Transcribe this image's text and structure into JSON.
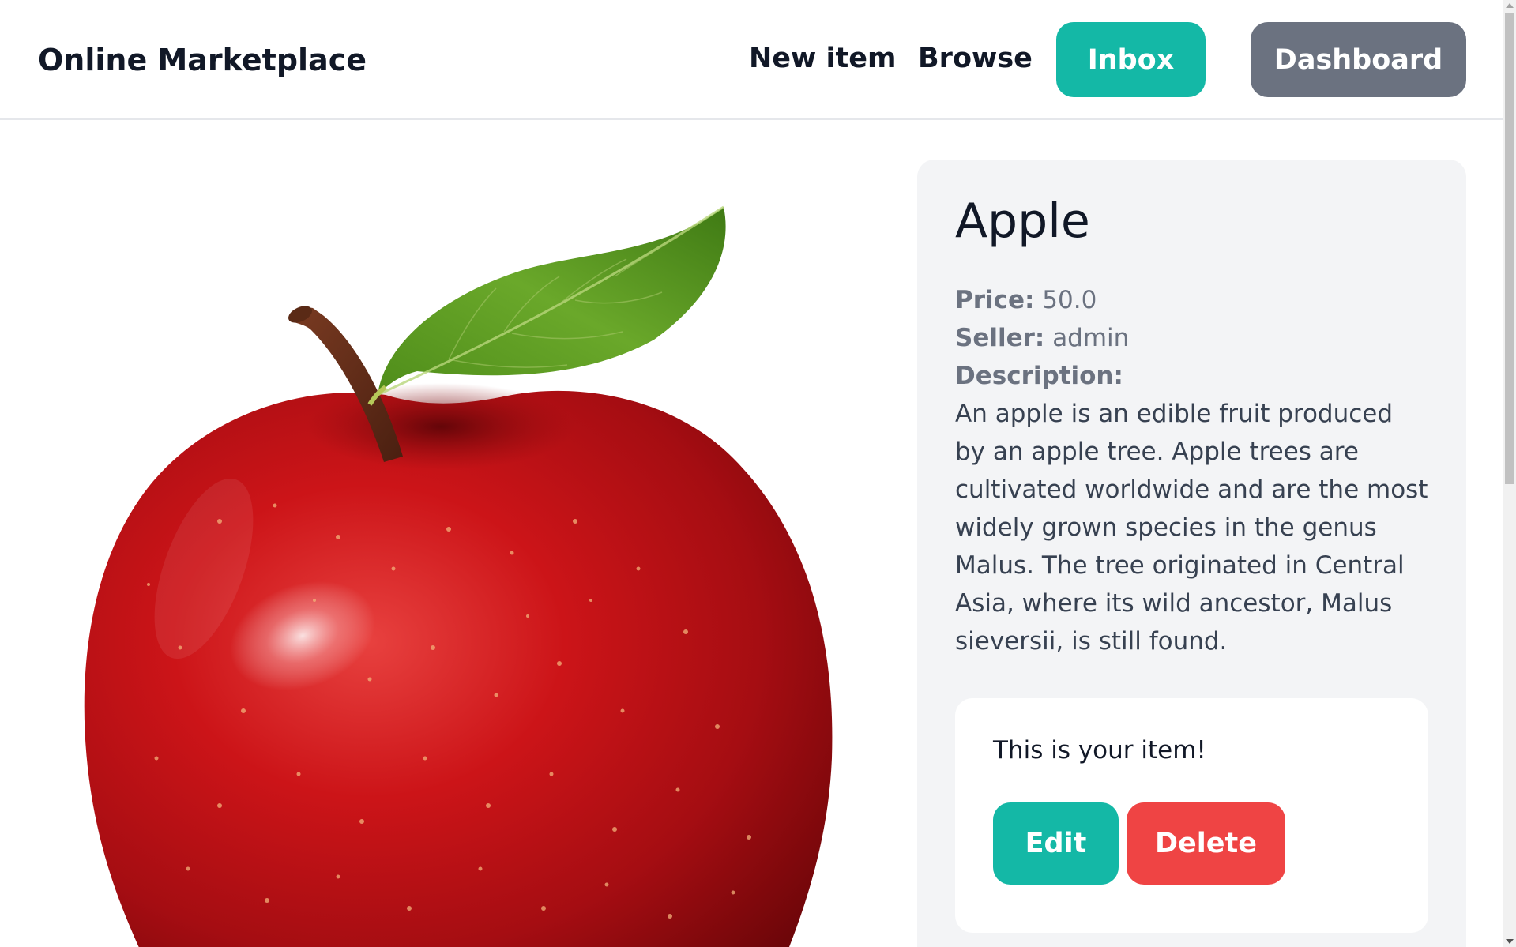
{
  "app": {
    "brand": "Online Marketplace"
  },
  "nav": {
    "new_item": "New item",
    "browse": "Browse",
    "inbox": "Inbox",
    "dashboard": "Dashboard"
  },
  "item": {
    "name": "Apple",
    "price_label": "Price:",
    "price": "50.0",
    "seller_label": "Seller:",
    "seller": "admin",
    "description_label": "Description:",
    "description": "An apple is an edible fruit produced by an apple tree. Apple trees are cultivated worldwide and are the most widely grown species in the genus Malus. The tree originated in Central Asia, where its wild ancestor, Malus sieversii, is still found.",
    "image_subject": "red-apple-with-leaf"
  },
  "owner": {
    "message": "This is your item!",
    "edit_label": "Edit",
    "delete_label": "Delete"
  },
  "colors": {
    "accent": "#14b8a6",
    "secondary": "#6b7280",
    "danger": "#ef4444",
    "panel_bg": "#f3f4f6"
  }
}
